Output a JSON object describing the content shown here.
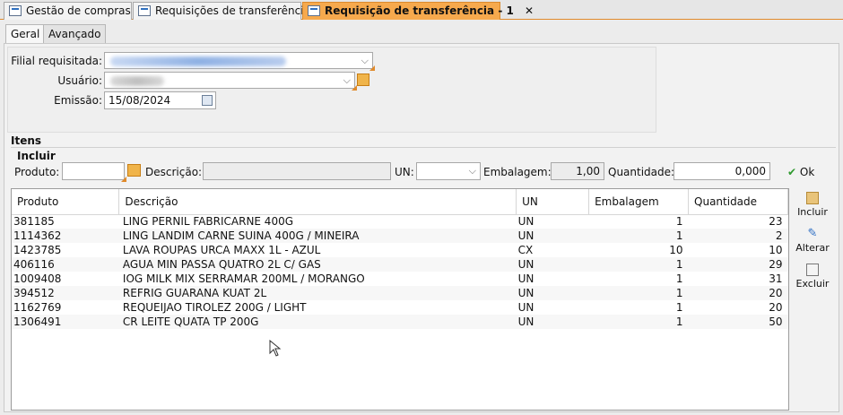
{
  "doc_tabs": [
    {
      "label": "Gestão de compras",
      "close": "✕"
    },
    {
      "label": "Requisições de transferência",
      "close": "✕"
    },
    {
      "label": "Requisição de transferência - 1",
      "close": "✕"
    }
  ],
  "sub_tabs": [
    "Geral",
    "Avançado"
  ],
  "header": {
    "filial_label": "Filial requisitada:",
    "usuario_label": "Usuário:",
    "emissao_label": "Emissão:",
    "emissao_value": "15/08/2024"
  },
  "itens": {
    "title": "Itens",
    "incluir_title": "Incluir",
    "produto_label": "Produto:",
    "descricao_label": "Descrição:",
    "un_label": "UN:",
    "embalagem_label": "Embalagem:",
    "embalagem_value": "1,00",
    "quantidade_label": "Quantidade:",
    "quantidade_value": "0,000",
    "ok_label": "Ok"
  },
  "grid": {
    "columns": [
      "Produto",
      "Descrição",
      "UN",
      "Embalagem",
      "Quantidade"
    ],
    "rows": [
      [
        "381185",
        "LING PERNIL FABRICARNE 400G",
        "UN",
        "1",
        "23"
      ],
      [
        "1114362",
        "LING LANDIM CARNE SUINA 400G / MINEIRA",
        "UN",
        "1",
        "2"
      ],
      [
        "1423785",
        "LAVA ROUPAS URCA MAXX 1L - AZUL",
        "CX",
        "10",
        "10"
      ],
      [
        "406116",
        "AGUA MIN PASSA QUATRO 2L C/ GAS",
        "UN",
        "1",
        "29"
      ],
      [
        "1009408",
        "IOG MILK MIX SERRAMAR 200ML / MORANGO",
        "UN",
        "1",
        "31"
      ],
      [
        "394512",
        "REFRIG GUARANA KUAT 2L",
        "UN",
        "1",
        "20"
      ],
      [
        "1162769",
        "REQUEIJAO TIROLEZ 200G / LIGHT",
        "UN",
        "1",
        "20"
      ],
      [
        "1306491",
        "CR LEITE QUATA TP 200G",
        "UN",
        "1",
        "50"
      ]
    ]
  },
  "side_buttons": [
    "Incluir",
    "Alterar",
    "Excluir"
  ],
  "colors": {
    "active_tab": "#f6a94d",
    "accent": "#e08a2b"
  }
}
